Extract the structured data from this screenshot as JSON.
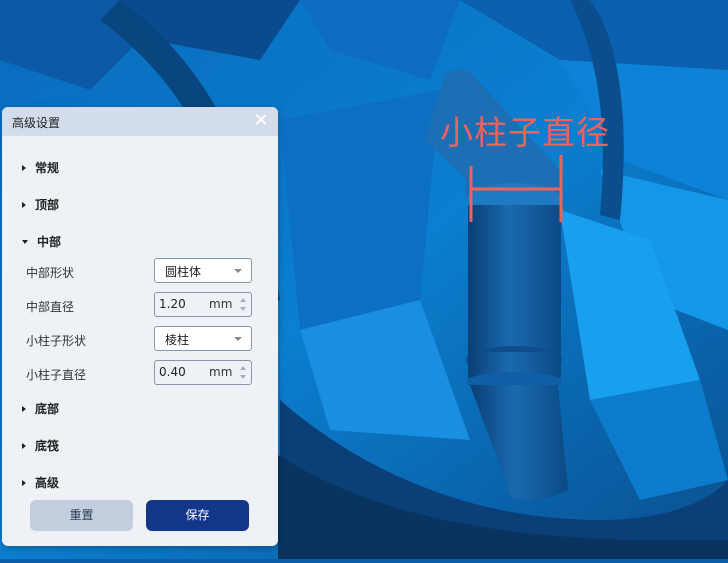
{
  "viewport": {
    "annotation_label": "小柱子直径",
    "annotation_color": "#f0625a",
    "background_color": "#0a5fa8"
  },
  "panel": {
    "title": "高级设置",
    "close_icon": "close-icon",
    "sections": {
      "general": "常规",
      "top": "顶部",
      "middle": "中部",
      "bottom": "底部",
      "base": "底筏",
      "advanced": "高级"
    },
    "middle": {
      "shape_label": "中部形状",
      "shape_value": "圆柱体",
      "diameter_label": "中部直径",
      "diameter_value": "1.20",
      "diameter_unit": "mm",
      "pillar_shape_label": "小柱子形状",
      "pillar_shape_value": "棱柱",
      "pillar_diameter_label": "小柱子直径",
      "pillar_diameter_value": "0.40",
      "pillar_diameter_unit": "mm"
    },
    "buttons": {
      "reset": "重置",
      "save": "保存"
    },
    "colors": {
      "save_button": "#14368a",
      "reset_button": "#c2cedd"
    }
  }
}
